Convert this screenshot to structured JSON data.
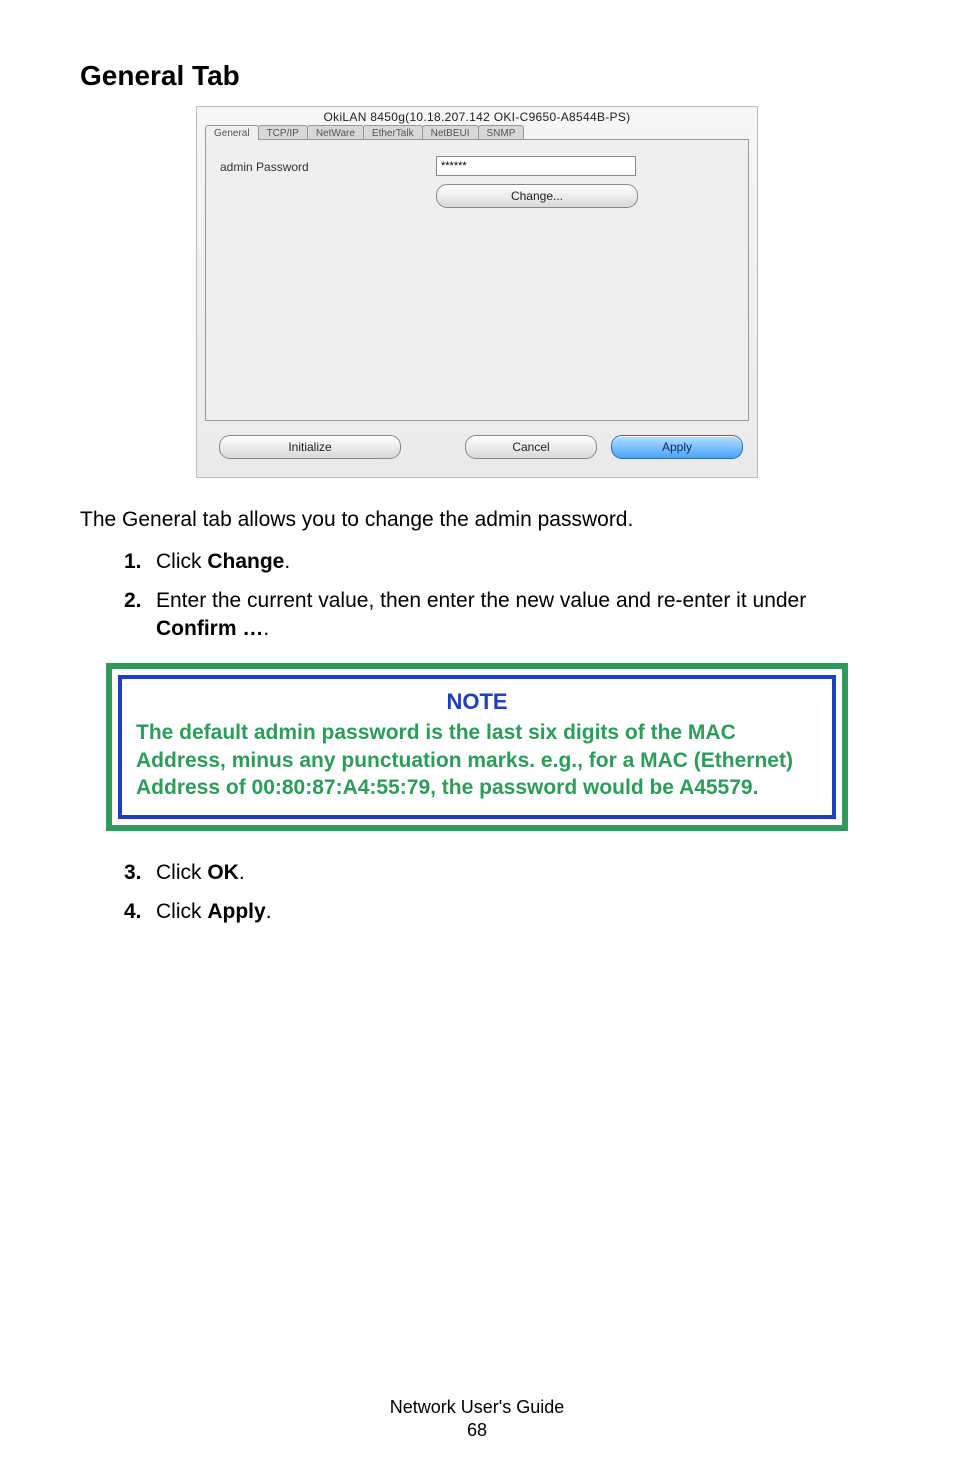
{
  "heading": "General Tab",
  "screenshot": {
    "windowTitle": "OkiLAN 8450g(10.18.207.142 OKI-C9650-A8544B-PS)",
    "tabs": [
      "General",
      "TCP/IP",
      "NetWare",
      "EtherTalk",
      "NetBEUI",
      "SNMP"
    ],
    "activeTab": 0,
    "passwordLabel": "admin Password",
    "passwordValue": "******",
    "changeLabel": "Change...",
    "buttons": {
      "initialize": "Initialize",
      "cancel": "Cancel",
      "apply": "Apply"
    }
  },
  "intro": "The General tab allows you to change the admin password.",
  "steps1": [
    {
      "n": "1.",
      "pre": "Click ",
      "bold": "Change",
      "post": "."
    },
    {
      "n": "2.",
      "pre": "Enter the current value, then enter the new value and re-enter it under ",
      "bold": "Confirm …",
      "post": "."
    }
  ],
  "note": {
    "title": "NOTE",
    "body": "The default admin password is the last six digits of the MAC Address, minus any punctuation marks. e.g., for a MAC (Ethernet) Address of 00:80:87:A4:55:79, the password would be A45579."
  },
  "steps2": [
    {
      "n": "3.",
      "pre": "Click ",
      "bold": "OK",
      "post": "."
    },
    {
      "n": "4.",
      "pre": "Click ",
      "bold": "Apply",
      "post": "."
    }
  ],
  "footer": {
    "title": "Network User's Guide",
    "page": "68"
  }
}
